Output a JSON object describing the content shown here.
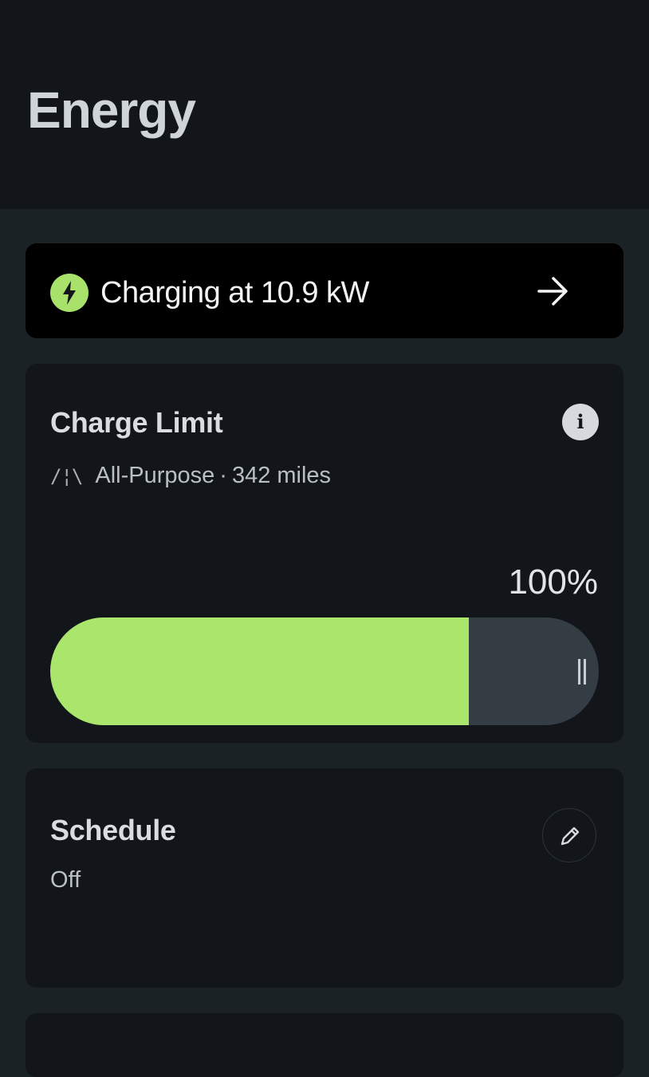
{
  "header": {
    "title": "Energy"
  },
  "charging_banner": {
    "text": "Charging at 10.9 kW",
    "icon": "lightning-bolt-icon",
    "action_icon": "arrow-right-icon",
    "accent_color": "#a8e26a"
  },
  "charge_limit": {
    "title": "Charge Limit",
    "info_icon_label": "i",
    "mode_icon_text": "/¦\\",
    "mode": "All-Purpose",
    "separator": "·",
    "range": "342 miles",
    "percent_label": "100%",
    "slider_fill_fraction": 0.763,
    "slider_fill_color": "#a9e66b"
  },
  "schedule": {
    "title": "Schedule",
    "state": "Off",
    "edit_icon": "pencil-icon"
  }
}
